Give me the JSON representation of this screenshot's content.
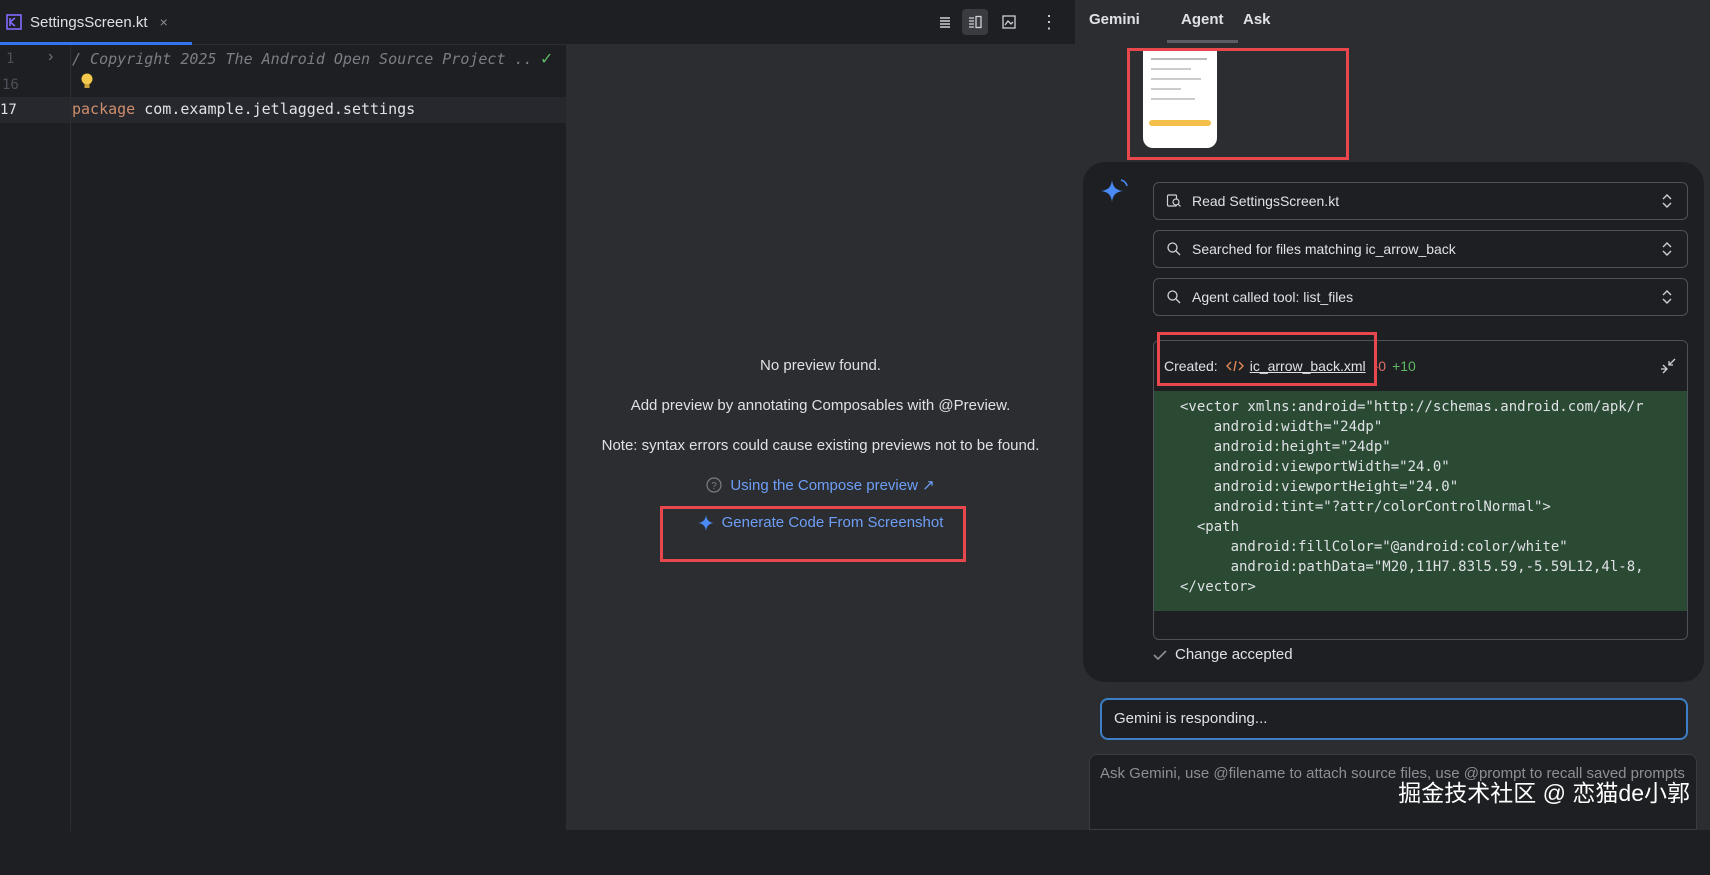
{
  "editor": {
    "tab": {
      "filename": "SettingsScreen.kt",
      "close": "×"
    },
    "lines": [
      {
        "number": "1",
        "text": "/ Copyright 2025 The Android Open Source Project .."
      },
      {
        "number": "16",
        "text": ""
      },
      {
        "number": "17",
        "keyword": "package",
        "text": " com.example.jetlagged.settings"
      }
    ],
    "fold_marker": "›",
    "checkmark": "✓"
  },
  "toolbar": {
    "view_modes": [
      "code-view",
      "split-view",
      "design-view"
    ],
    "more": "⋮"
  },
  "preview": {
    "no_preview": "No preview found.",
    "add_preview": "Add preview by annotating Composables with @Preview.",
    "note": "Note: syntax errors could cause existing previews not to be found.",
    "compose_link": "Using the Compose preview ↗",
    "generate_button": "Generate Code From Screenshot"
  },
  "gemini": {
    "tabs": [
      "Gemini",
      "Agent",
      "Ask"
    ],
    "active_tab": "Agent",
    "tool_calls": [
      {
        "label": "Read SettingsScreen.kt",
        "icon": "file-search-icon"
      },
      {
        "label": "Searched for files matching ic_arrow_back",
        "icon": "search-icon"
      },
      {
        "label": "Agent called tool: list_files",
        "icon": "search-icon"
      }
    ],
    "created": {
      "prefix": "Created:",
      "filename": "ic_arrow_back.xml",
      "removed": "-0",
      "added": "+10"
    },
    "code_lines": [
      "<vector xmlns:android=\"http://schemas.android.com/apk/r",
      "    android:width=\"24dp\"",
      "    android:height=\"24dp\"",
      "    android:viewportWidth=\"24.0\"",
      "    android:viewportHeight=\"24.0\"",
      "    android:tint=\"?attr/colorControlNormal\">",
      "  <path",
      "      android:fillColor=\"@android:color/white\"",
      "      android:pathData=\"M20,11H7.83l5.59,-5.59L12,4l-8,",
      "</vector>"
    ],
    "change_status": "Change accepted",
    "responding": "Gemini is responding...",
    "prompt_placeholder": "Ask Gemini, use @filename to attach source files, use @prompt to recall saved prompts"
  },
  "watermark": "掘金技术社区 @ 恋猫de小郭",
  "colors": {
    "accent": "#3574f0",
    "highlight": "#e8474d",
    "diff_bg": "#2a4a34",
    "link": "#6f9ef8"
  }
}
